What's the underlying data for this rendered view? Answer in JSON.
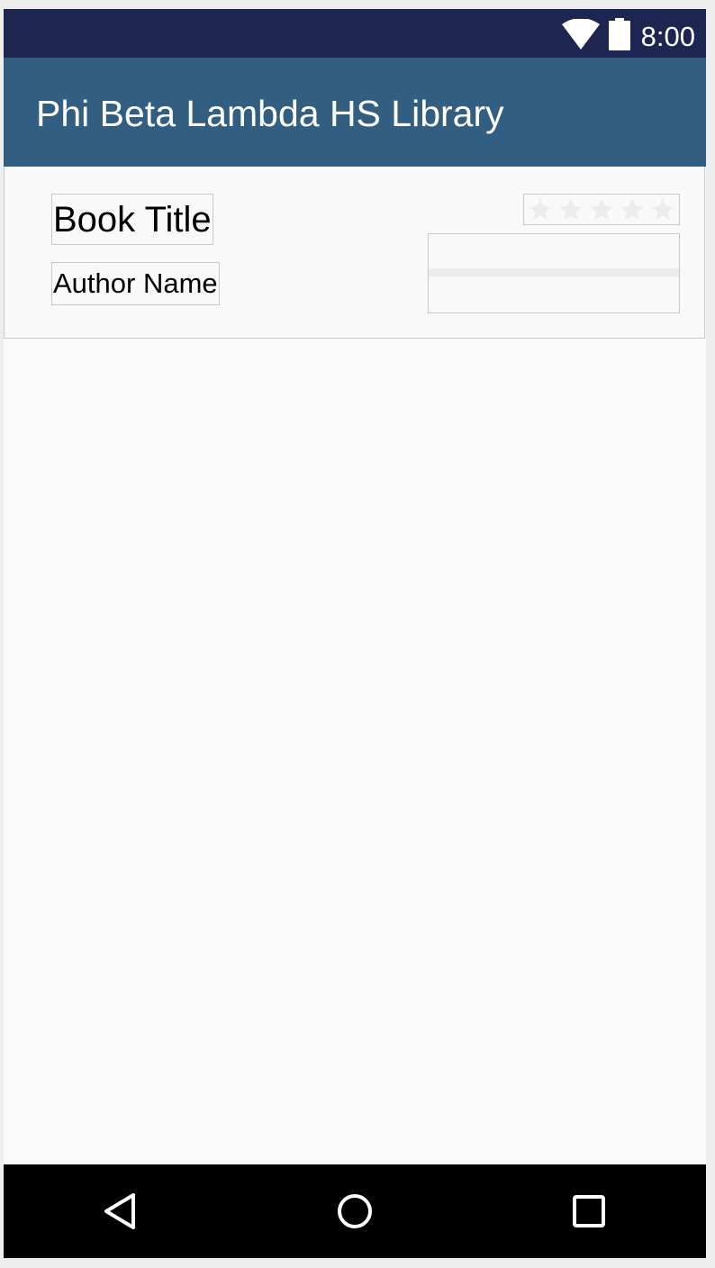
{
  "status_bar": {
    "time": "8:00",
    "icons": [
      "wifi-icon",
      "battery-icon"
    ]
  },
  "app_bar": {
    "title": "Phi Beta Lambda HS Library"
  },
  "book": {
    "title": "Book Title",
    "author": "Author Name",
    "rating": 0,
    "rating_max": 5,
    "progress": 0
  },
  "nav_bar": {
    "icons": [
      "back-icon",
      "home-icon",
      "recents-icon"
    ]
  },
  "colors": {
    "status_bar": "#1c2651",
    "app_bar": "#325e82",
    "background": "#fafafa",
    "star_empty": "#ececec",
    "nav_bar": "#000000"
  }
}
